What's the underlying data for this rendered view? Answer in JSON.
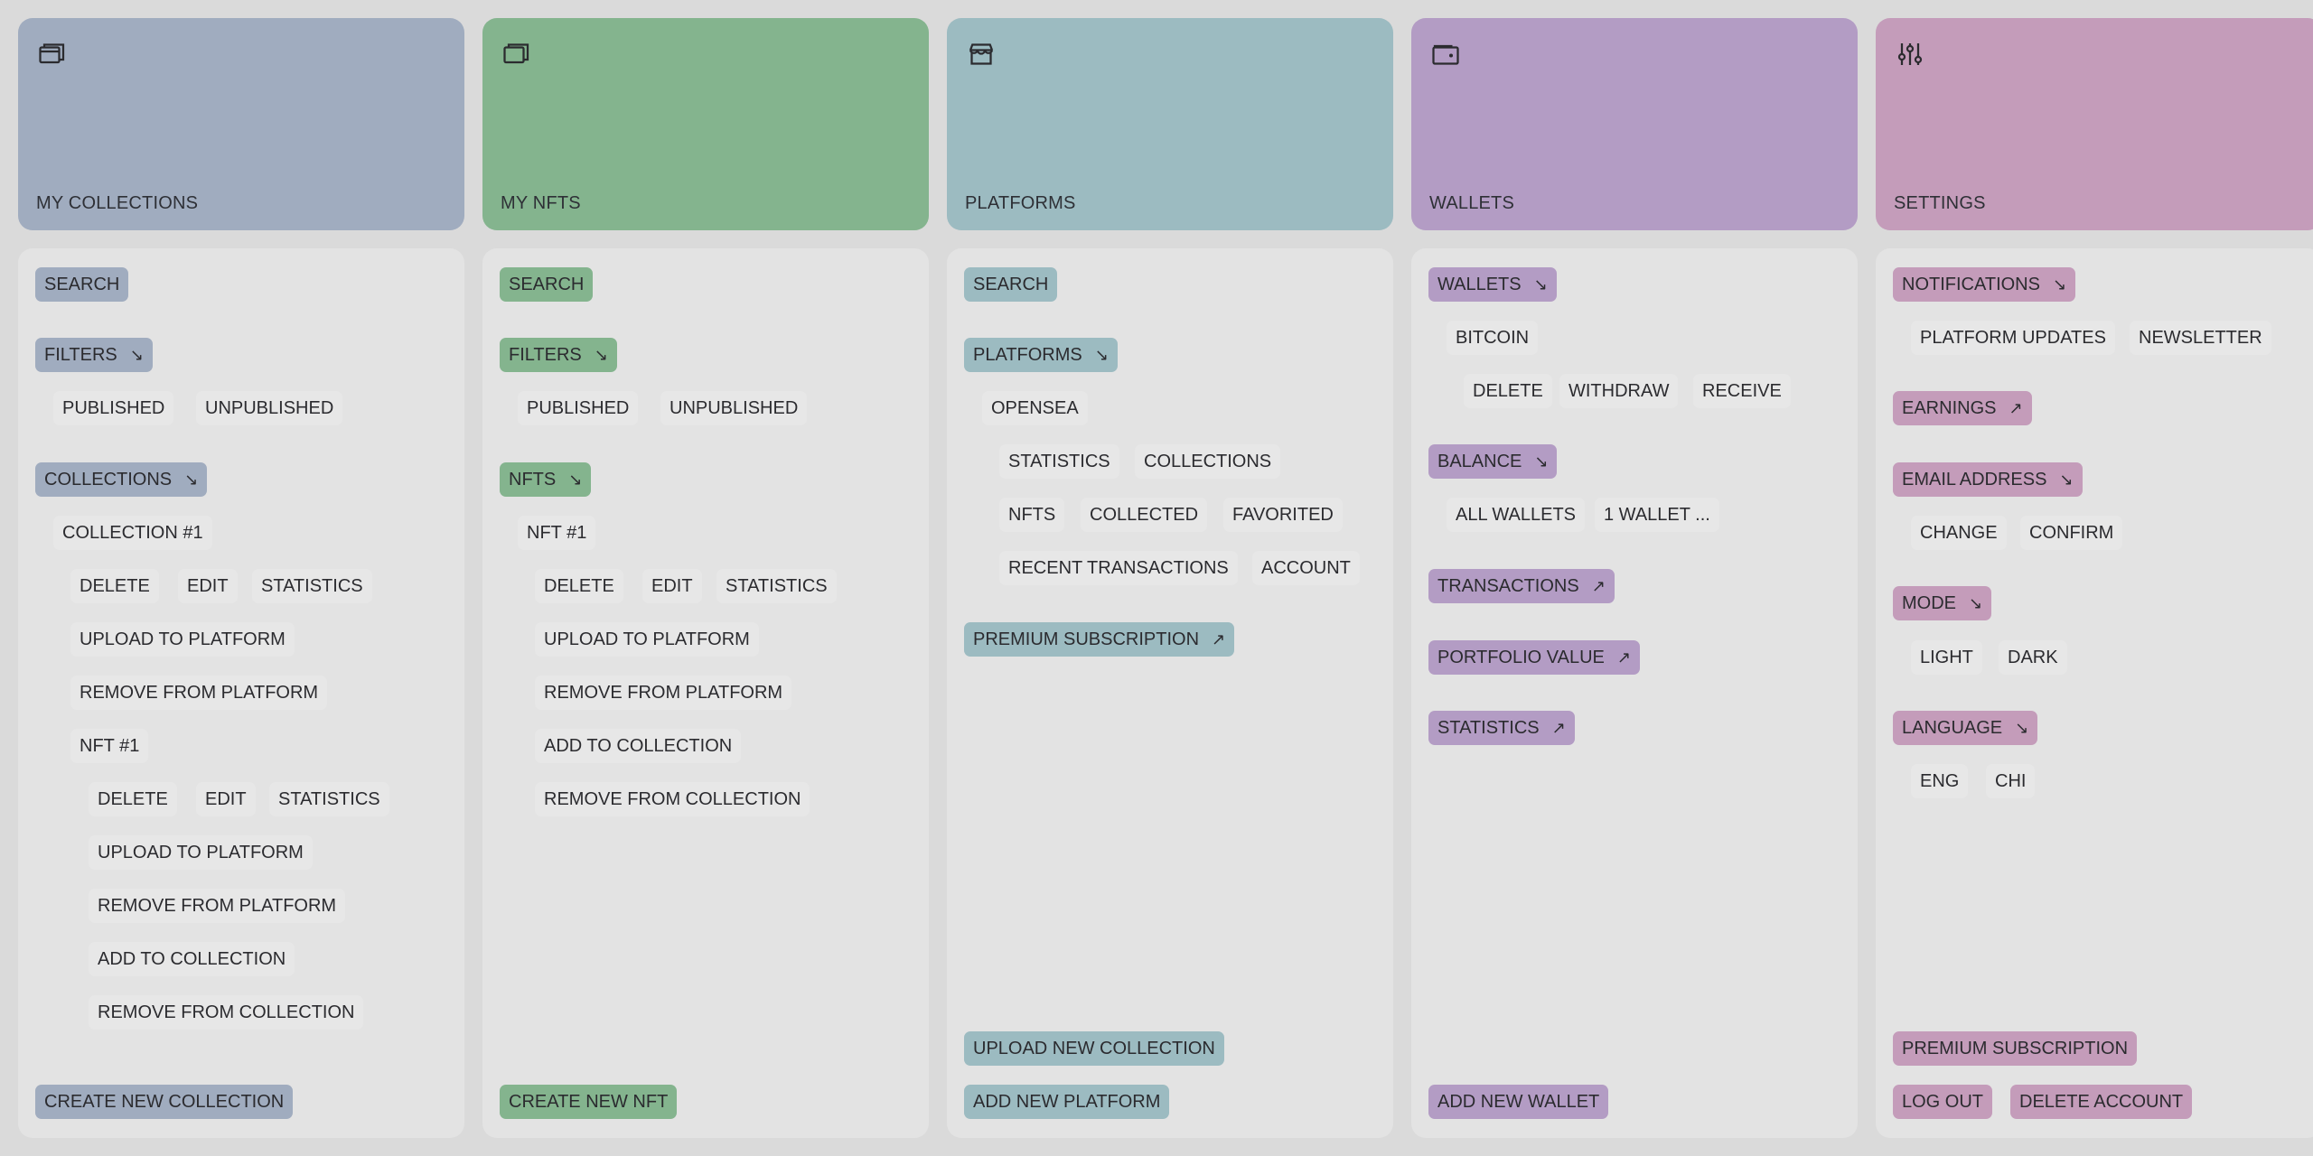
{
  "colors": {
    "background": "#dadada",
    "panel": "#e3e3e3",
    "my_collections": "#a0acbf",
    "my_nfts": "#84b48e",
    "platforms": "#9cbbc1",
    "wallets": "#b39cc4",
    "settings": "#c49cba"
  },
  "arrows": {
    "expand": "↘",
    "external": "↗"
  },
  "my_collections": {
    "title": "MY COLLECTIONS",
    "icon": "stacked-cards-icon",
    "search": "SEARCH",
    "filters": "FILTERS",
    "filter_options": [
      "PUBLISHED",
      "UNPUBLISHED"
    ],
    "collections": "COLLECTIONS",
    "collection_item": "COLLECTION #1",
    "collection_actions": [
      "DELETE",
      "EDIT",
      "STATISTICS"
    ],
    "upload_to_platform": "UPLOAD TO PLATFORM",
    "remove_from_platform": "REMOVE FROM PLATFORM",
    "nft_item": "NFT #1",
    "nft_actions": [
      "DELETE",
      "EDIT",
      "STATISTICS"
    ],
    "nft_upload_to_platform": "UPLOAD TO PLATFORM",
    "nft_remove_from_platform": "REMOVE FROM PLATFORM",
    "nft_add_to_collection": "ADD TO COLLECTION",
    "nft_remove_from_collection": "REMOVE FROM COLLECTION",
    "create_new": "CREATE NEW COLLECTION"
  },
  "my_nfts": {
    "title": "MY NFTS",
    "icon": "stacked-cards-icon",
    "search": "SEARCH",
    "filters": "FILTERS",
    "filter_options": [
      "PUBLISHED",
      "UNPUBLISHED"
    ],
    "nfts": "NFTS",
    "nft_item": "NFT #1",
    "nft_actions": [
      "DELETE",
      "EDIT",
      "STATISTICS"
    ],
    "upload_to_platform": "UPLOAD TO PLATFORM",
    "remove_from_platform": "REMOVE FROM PLATFORM",
    "add_to_collection": "ADD TO COLLECTION",
    "remove_from_collection": "REMOVE FROM COLLECTION",
    "create_new": "CREATE NEW NFT"
  },
  "platforms": {
    "title": "PLATFORMS",
    "icon": "storefront-icon",
    "search": "SEARCH",
    "platforms": "PLATFORMS",
    "platform_item": "OPENSEA",
    "platform_row1": [
      "STATISTICS",
      "COLLECTIONS"
    ],
    "platform_row2": [
      "NFTS",
      "COLLECTED",
      "FAVORITED"
    ],
    "platform_row3": [
      "RECENT TRANSACTIONS",
      "ACCOUNT"
    ],
    "premium": "PREMIUM SUBSCRIPTION",
    "upload_new_collection": "UPLOAD NEW COLLECTION",
    "add_new_platform": "ADD NEW PLATFORM"
  },
  "wallets": {
    "title": "WALLETS",
    "icon": "wallet-icon",
    "wallets": "WALLETS",
    "wallet_item": "BITCOIN",
    "wallet_actions": [
      "DELETE",
      "WITHDRAW",
      "RECEIVE"
    ],
    "balance": "BALANCE",
    "balance_options": [
      "ALL WALLETS",
      "1 WALLET ..."
    ],
    "transactions": "TRANSACTIONS",
    "portfolio_value": "PORTFOLIO VALUE",
    "statistics": "STATISTICS",
    "add_new_wallet": "ADD NEW WALLET"
  },
  "settings": {
    "title": "SETTINGS",
    "icon": "sliders-icon",
    "notifications": "NOTIFICATIONS",
    "notification_options": [
      "PLATFORM UPDATES",
      "NEWSLETTER"
    ],
    "earnings": "EARNINGS",
    "email_address": "EMAIL ADDRESS",
    "email_options": [
      "CHANGE",
      "CONFIRM"
    ],
    "mode": "MODE",
    "mode_options": [
      "LIGHT",
      "DARK"
    ],
    "language": "LANGUAGE",
    "language_options": [
      "ENG",
      "CHI"
    ],
    "premium": "PREMIUM SUBSCRIPTION",
    "log_out": "LOG OUT",
    "delete_account": "DELETE ACCOUNT"
  }
}
